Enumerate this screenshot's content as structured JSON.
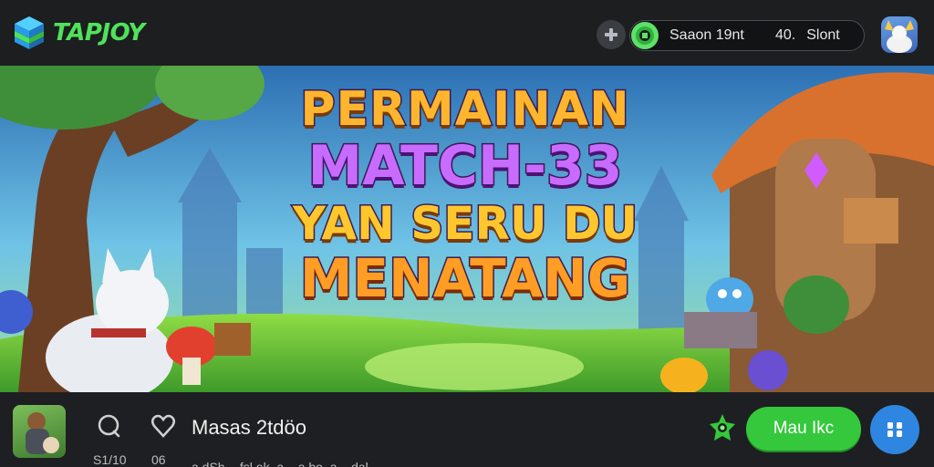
{
  "header": {
    "brand": {
      "tap": "TAP",
      "joy": "JOY"
    },
    "gamepad_icon": "gamepad-icon",
    "reward_pill": {
      "name": "Saaon 19nt",
      "count": "40.",
      "unit": "Slont"
    },
    "avatar_icon": "user-avatar"
  },
  "banner": {
    "title_lines": [
      "PERMAINAN",
      "MATCH-33",
      "YAN SERU DU",
      "MENATANG"
    ]
  },
  "footer": {
    "game_name": "Masas 2tdöo",
    "stats": {
      "comments": "S1/10",
      "likes": "06"
    },
    "subline": "a dSh · ,fsl,ek,,a.,,,a,bo,,a..,,dal,",
    "play_label": "Mau Ikc",
    "icons": [
      "comment-icon",
      "heart-icon",
      "gem-icon",
      "menu-grid-icon"
    ]
  },
  "colors": {
    "brand_green": "#4fe25a",
    "play_green": "#35c83c",
    "menu_blue": "#2e86e0",
    "bar_bg": "#1e1f22"
  }
}
